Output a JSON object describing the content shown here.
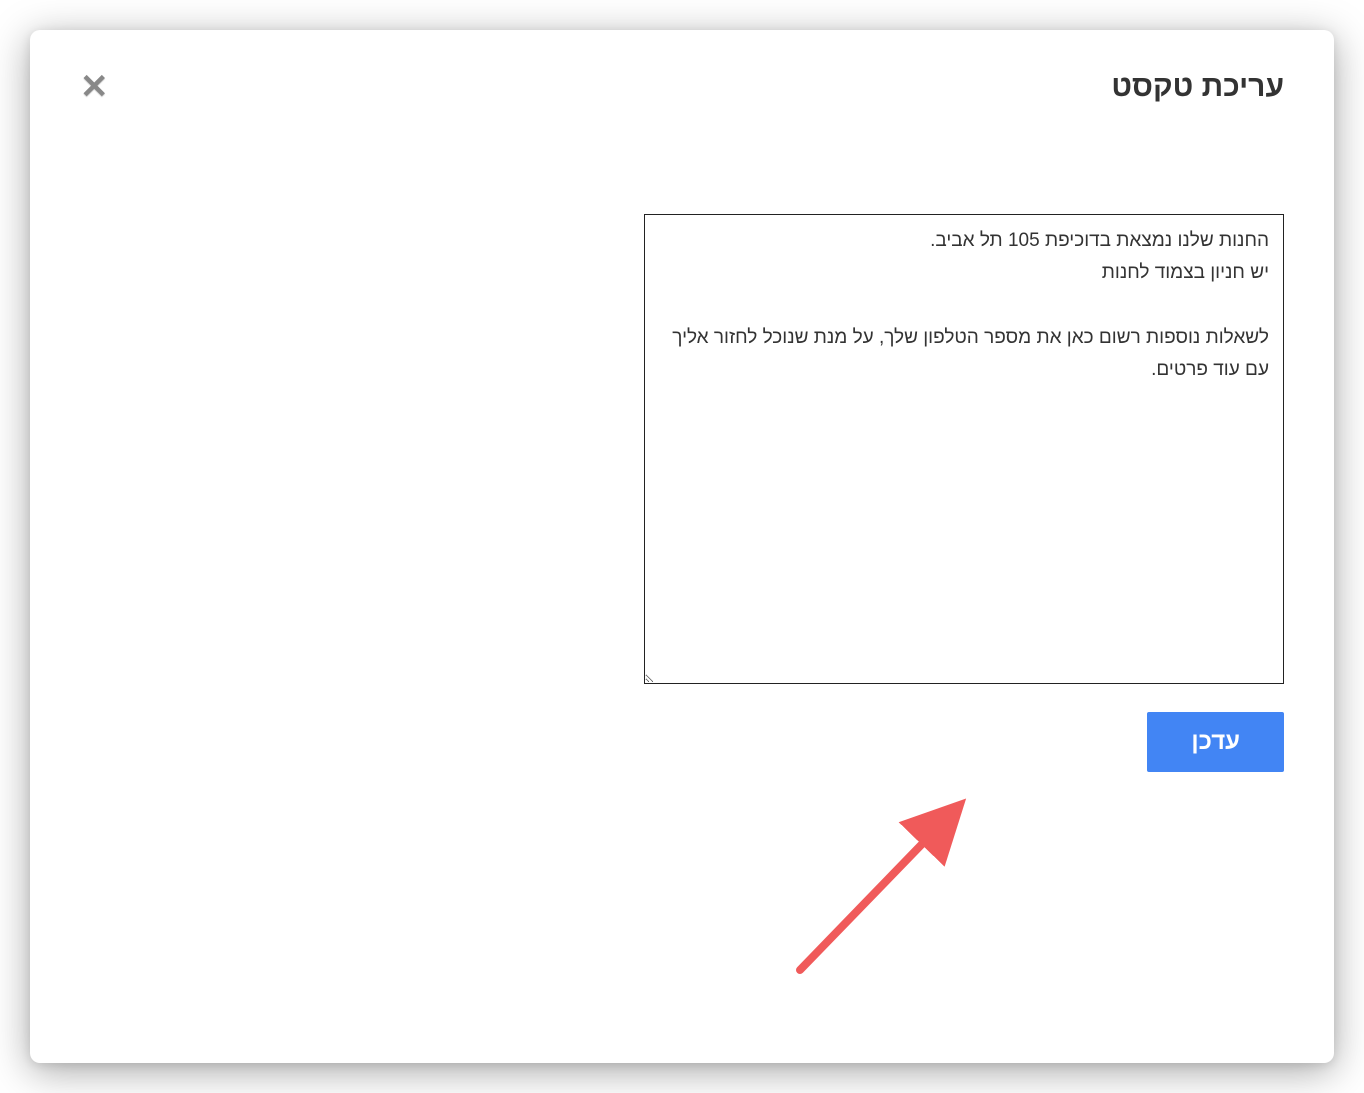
{
  "modal": {
    "title": "עריכת טקסט",
    "textarea_value": "החנות שלנו נמצאת בדוכיפת 105 תל אביב.\nיש חניון בצמוד לחנות\n\nלשאלות נוספות רשום כאן את מספר הטלפון שלך, על מנת שנוכל לחזור אליך עם עוד פרטים.",
    "update_button_label": "עדכן"
  },
  "colors": {
    "primary_button": "#4285f4",
    "annotation_arrow": "#f05a5a"
  }
}
